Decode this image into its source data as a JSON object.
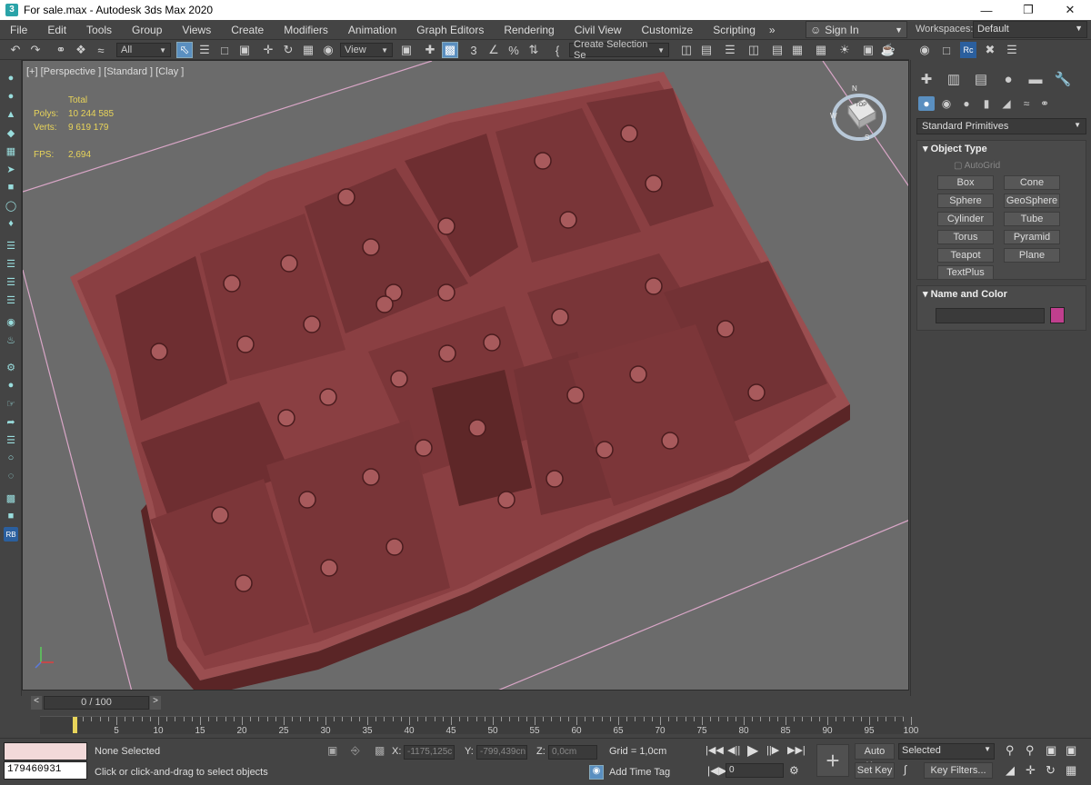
{
  "window": {
    "title": "For sale.max - Autodesk 3ds Max 2020"
  },
  "menu": [
    "File",
    "Edit",
    "Tools",
    "Group",
    "Views",
    "Create",
    "Modifiers",
    "Animation",
    "Graph Editors",
    "Rendering",
    "Civil View",
    "Customize",
    "Scripting"
  ],
  "menu_more": "»",
  "signin": "Sign In",
  "workspaces": {
    "label": "Workspaces:",
    "value": "Default"
  },
  "toolbar": {
    "filter": "All",
    "ref_coord": "View",
    "selection_set": "Create Selection Se"
  },
  "viewport": {
    "label": "[+] [Perspective ] [Standard ] [Clay ]",
    "stats": {
      "header": "Total",
      "polys_label": "Polys:",
      "polys": "10 244 585",
      "verts_label": "Verts:",
      "verts": "9 619 179",
      "fps_label": "FPS:",
      "fps": "2,694"
    },
    "viewcube": {
      "face": "TOP",
      "n": "N",
      "w": "W",
      "s": "S"
    }
  },
  "command_panel": {
    "category": "Standard Primitives",
    "object_type": {
      "title": "Object Type",
      "autogrid": "AutoGrid",
      "buttons": [
        "Box",
        "Cone",
        "Sphere",
        "GeoSphere",
        "Cylinder",
        "Tube",
        "Torus",
        "Pyramid",
        "Teapot",
        "Plane",
        "TextPlus"
      ]
    },
    "name_color": {
      "title": "Name and Color",
      "name": "",
      "color": "#c03f8e"
    }
  },
  "timeline": {
    "position": "0 / 100",
    "ticks": [
      0,
      5,
      10,
      15,
      20,
      25,
      30,
      35,
      40,
      45,
      50,
      55,
      60,
      65,
      70,
      75,
      80,
      85,
      90,
      95,
      100
    ]
  },
  "status": {
    "maxscript": "179460931",
    "selection": "None Selected",
    "prompt": "Click or click-and-drag to select objects",
    "x_label": "X:",
    "x": "-1175,125c",
    "y_label": "Y:",
    "y": "-799,439cn",
    "z_label": "Z:",
    "z": "0,0cm",
    "grid": "Grid = 1,0cm",
    "add_time_tag": "Add Time Tag",
    "auto_key": "Auto Key",
    "set_key": "Set Key",
    "key_mode": "Selected",
    "key_filters": "Key Filters...",
    "frame": "0"
  }
}
